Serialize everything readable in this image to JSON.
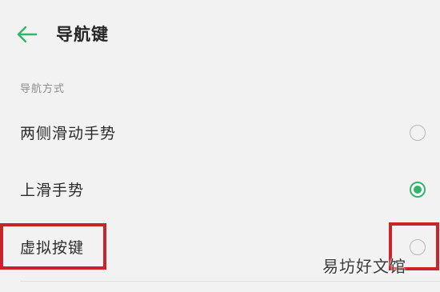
{
  "header": {
    "back_icon": "arrow-left-icon",
    "title": "导航键"
  },
  "section": {
    "label": "导航方式"
  },
  "options": [
    {
      "label": "两侧滑动手势",
      "selected": false
    },
    {
      "label": "上滑手势",
      "selected": true
    },
    {
      "label": "虚拟按键",
      "selected": false
    }
  ],
  "watermark": "易坊好文馆",
  "colors": {
    "accent": "#31b56b",
    "highlight": "#c8242a",
    "background": "#f2f2f2"
  }
}
